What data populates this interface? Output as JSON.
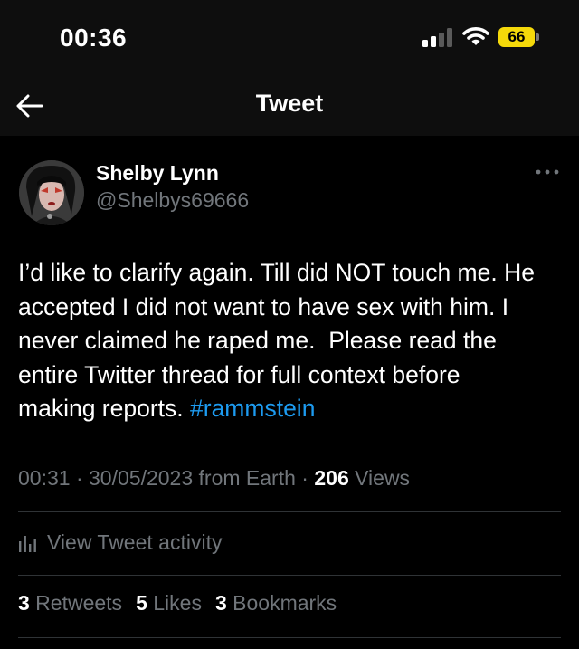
{
  "status_bar": {
    "time": "00:36",
    "battery": "66"
  },
  "nav": {
    "title": "Tweet"
  },
  "author": {
    "display_name": "Shelby Lynn",
    "handle": "@Shelbys69666"
  },
  "tweet": {
    "lines": [
      "I’d like to clarify again. Till did NOT touch me. He",
      "accepted I did not want to have sex with him. I",
      "never claimed he raped me.  Please read the",
      "entire Twitter thread for full context before"
    ],
    "last_line_prefix": "making reports. ",
    "hashtag": "#rammstein"
  },
  "meta": {
    "time": "00:31",
    "separator": " · ",
    "date": "30/05/2023",
    "source": " from Earth",
    "views_count": "206",
    "views_label": " Views"
  },
  "activity": {
    "label": "View Tweet activity"
  },
  "stats": {
    "retweets_count": "3",
    "retweets_label": " Retweets",
    "likes_count": "5",
    "likes_label": " Likes",
    "bookmarks_count": "3",
    "bookmarks_label": " Bookmarks"
  },
  "colors": {
    "background": "#000000",
    "accent": "#1d9bf0",
    "muted": "#71767b",
    "battery": "#f5d90a"
  },
  "icons": {
    "back": "back-arrow-icon",
    "more": "more-horizontal-icon",
    "activity": "bar-chart-icon",
    "signal": "cellular-signal-icon",
    "wifi": "wifi-icon",
    "battery": "battery-icon"
  }
}
